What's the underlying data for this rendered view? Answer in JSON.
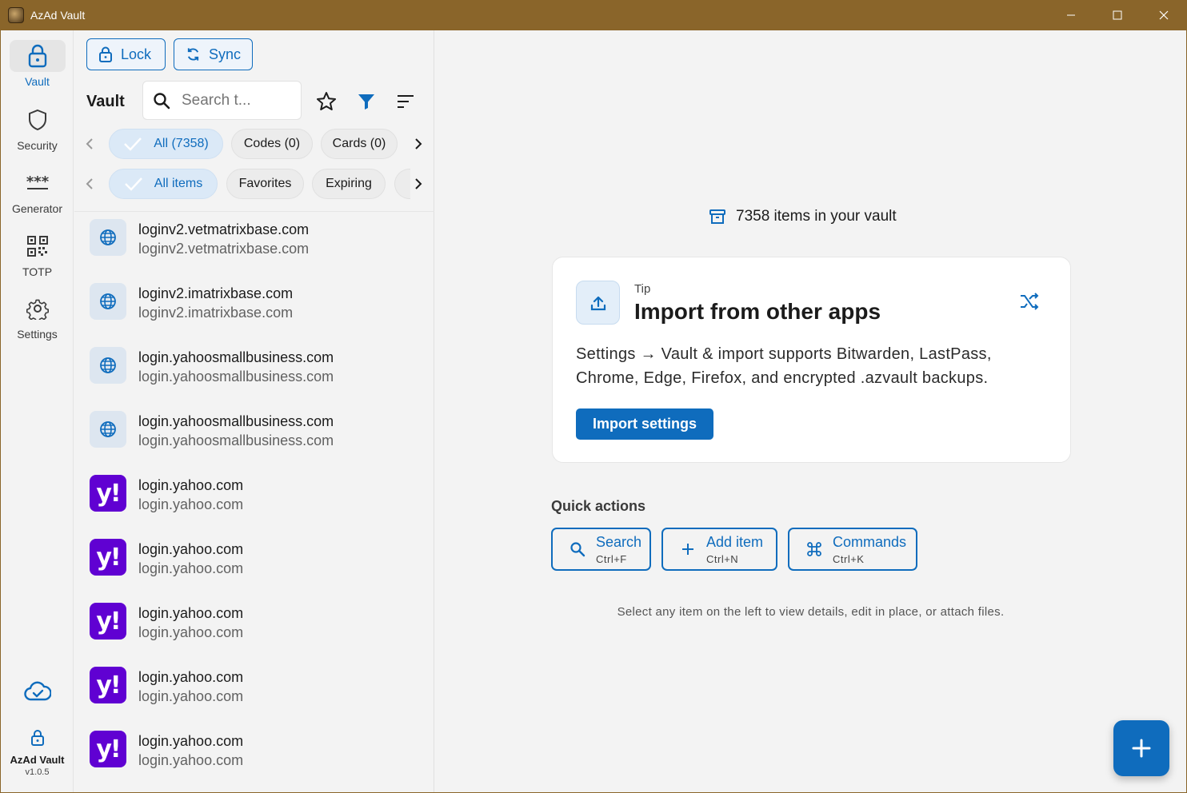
{
  "window": {
    "title": "AzAd Vault"
  },
  "rail": {
    "items": [
      {
        "label": "Vault",
        "icon": "lock-icon",
        "active": true
      },
      {
        "label": "Security",
        "icon": "shield-icon"
      },
      {
        "label": "Generator",
        "icon": "password-dots-icon"
      },
      {
        "label": "TOTP",
        "icon": "qr-code-icon"
      },
      {
        "label": "Settings",
        "icon": "gear-icon"
      }
    ],
    "sync_status_icon": "cloud-check-icon",
    "brand": {
      "name": "AzAd Vault",
      "version": "v1.0.5"
    }
  },
  "toolbar": {
    "lock_label": "Lock",
    "sync_label": "Sync"
  },
  "vault": {
    "title": "Vault",
    "search_placeholder": "Search t..."
  },
  "type_filters": [
    {
      "label": "All (7358)",
      "selected": true
    },
    {
      "label": "Codes (0)"
    },
    {
      "label": "Cards (0)"
    }
  ],
  "view_filters": [
    {
      "label": "All items",
      "selected": true
    },
    {
      "label": "Favorites"
    },
    {
      "label": "Expiring"
    }
  ],
  "items": [
    {
      "title": "loginv2.vetmatrixbase.com",
      "subtitle": "loginv2.vetmatrixbase.com",
      "icon": "globe-icon"
    },
    {
      "title": "loginv2.imatrixbase.com",
      "subtitle": "loginv2.imatrixbase.com",
      "icon": "globe-icon"
    },
    {
      "title": "login.yahoosmallbusiness.com",
      "subtitle": "login.yahoosmallbusiness.com",
      "icon": "globe-icon"
    },
    {
      "title": "login.yahoosmallbusiness.com",
      "subtitle": "login.yahoosmallbusiness.com",
      "icon": "globe-icon"
    },
    {
      "title": "login.yahoo.com",
      "subtitle": "login.yahoo.com",
      "icon": "yahoo-logo"
    },
    {
      "title": "login.yahoo.com",
      "subtitle": "login.yahoo.com",
      "icon": "yahoo-logo"
    },
    {
      "title": "login.yahoo.com",
      "subtitle": "login.yahoo.com",
      "icon": "yahoo-logo"
    },
    {
      "title": "login.yahoo.com",
      "subtitle": "login.yahoo.com",
      "icon": "yahoo-logo"
    },
    {
      "title": "login.yahoo.com",
      "subtitle": "login.yahoo.com",
      "icon": "yahoo-logo"
    }
  ],
  "yahoo_logo_text": "y!",
  "main": {
    "count_text": "7358 items in your vault",
    "tip": {
      "label": "Tip",
      "title": "Import from other apps",
      "body": "Settings → Vault & import supports Bitwarden, LastPass, Chrome, Edge, Firefox, and encrypted .azvault backups.",
      "button": "Import settings"
    },
    "quick_actions": {
      "label": "Quick actions",
      "actions": [
        {
          "label": "Search",
          "shortcut": "Ctrl+F",
          "icon": "search-icon"
        },
        {
          "label": "Add item",
          "shortcut": "Ctrl+N",
          "icon": "plus-icon"
        },
        {
          "label": "Commands",
          "shortcut": "Ctrl+K",
          "icon": "command-icon"
        }
      ]
    },
    "hint": "Select any item on the left to view details, edit in place, or attach files."
  },
  "colors": {
    "accent": "#0f6cbd",
    "titlebar": "#8a652a",
    "yahoo": "#6001d2"
  }
}
